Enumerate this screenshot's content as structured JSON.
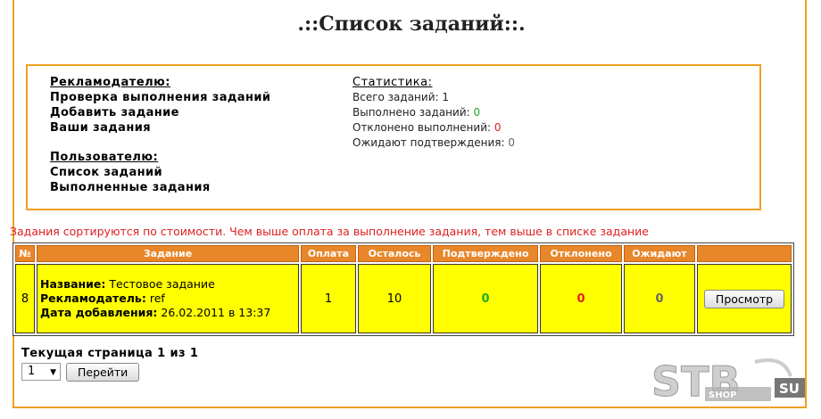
{
  "page": {
    "title": ".::Список заданий::."
  },
  "advertiser": {
    "heading": "Рекламодателю:",
    "links": [
      "Проверка выполнения заданий",
      "Добавить задание",
      "Ваши задания"
    ]
  },
  "user": {
    "heading": "Пользователю:",
    "links": [
      "Список заданий",
      "Выполненные задания"
    ]
  },
  "stats": {
    "heading": "Статистика:",
    "total_label": "Всего заданий:",
    "total_value": "1",
    "done_label": "Выполнено заданий:",
    "done_value": "0",
    "rejected_label": "Отклонено выполнений:",
    "rejected_value": "0",
    "pending_label": "Ожидают подтверждения:",
    "pending_value": "0"
  },
  "note": "Задания сортируются по стоимости. Чем выше оплата за выполнение задания, тем выше в списке задание",
  "table": {
    "headers": [
      "№",
      "Задание",
      "Оплата",
      "Осталось",
      "Подтверждено",
      "Отклонено",
      "Ожидают",
      ""
    ],
    "rows": [
      {
        "num": "8",
        "name_label": "Название:",
        "name": "Тестовое задание",
        "adv_label": "Рекламодатель:",
        "adv": "ref",
        "date_label": "Дата добавления:",
        "date": "26.02.2011 в 13:37",
        "pay": "1",
        "left": "10",
        "confirmed": "0",
        "rejected": "0",
        "waiting": "0",
        "action": "Просмотр"
      }
    ]
  },
  "pager": {
    "text": "Текущая страница 1 из 1",
    "selected": "1",
    "go_label": "Перейти"
  },
  "watermark": {
    "text": "STB",
    "sub": "SU",
    "small": "SHOP"
  },
  "colors": {
    "accent": "#f0a020",
    "header_bg": "#e8862a",
    "row_bg": "#ffff00",
    "note": "#e02020",
    "green": "#22aa22",
    "red": "#dd2222"
  }
}
